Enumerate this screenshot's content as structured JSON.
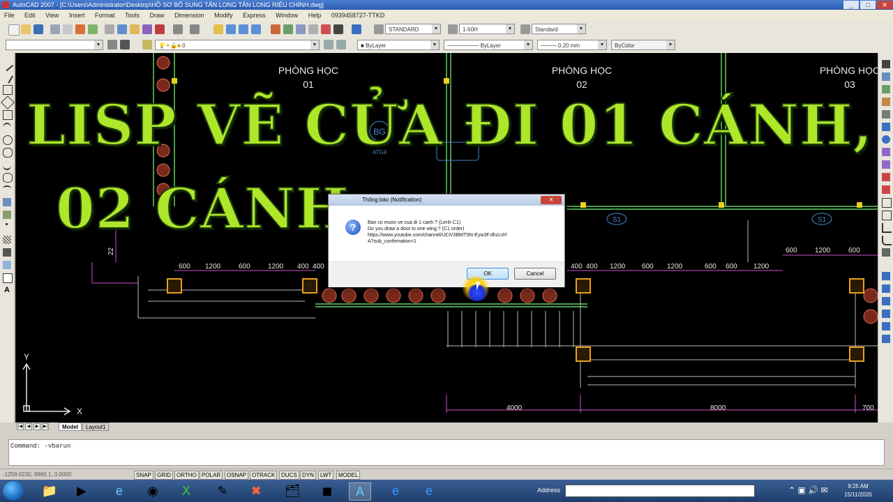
{
  "window": {
    "title": "AutoCAD 2007 - [C:\\Users\\Administrator\\Desktop\\HỒ SƠ BỔ SUNG TÂN LONG TÂN LONG RIÊU CHÍNH.dwg]",
    "minimize": "_",
    "maximize": "□",
    "close": "✕"
  },
  "menu": [
    "File",
    "Edit",
    "View",
    "Insert",
    "Format",
    "Tools",
    "Draw",
    "Dimension",
    "Modify",
    "Express",
    "Window",
    "Help",
    "0939458727-TTKD"
  ],
  "toolbar": {
    "text_style": "STANDARD",
    "dim_style": "1-50H",
    "table_style": "Standard",
    "layer_value": "0",
    "color": "ByLayer",
    "linetype": "ByLayer",
    "lineweight": "0.20 mm",
    "plot_style": "ByColor"
  },
  "drawing": {
    "rooms": [
      {
        "name": "PHÒNG HỌC",
        "number": "01"
      },
      {
        "name": "PHÒNG HỌC",
        "number": "02"
      },
      {
        "name": "PHÒNG HỌC",
        "number": "03"
      }
    ],
    "tags": [
      "S1",
      "S1",
      "BG",
      "ATG4"
    ],
    "dims_left": [
      "600",
      "1200",
      "600",
      "1200",
      "400",
      "400"
    ],
    "dims_mid": [
      "400",
      "400",
      "1200",
      "600",
      "1200",
      "600",
      "600",
      "1200"
    ],
    "dims_right_upper": [
      "600",
      "1200",
      "600"
    ],
    "dims_bottom": [
      "4000",
      "8000",
      "700"
    ],
    "side_dim": "22",
    "axis": {
      "x": "X",
      "y": "Y"
    }
  },
  "overlay": {
    "line1": "LISP VẼ CỬA ĐI 01 CÁNH,",
    "line2": "02 CÁNH"
  },
  "dialog": {
    "title": "Thông báo (Notification)",
    "close": "✕",
    "icon": "?",
    "message": [
      "Ban co muon ve cua di 1 canh ? (Lenh C1)",
      "Do you draw a door to one wing ? (C1 order)",
      "https://www.youtube.com/channel/UCiV3BMTSN-Eyw3F.dhzLVrf",
      "A?sub_confirmation=1"
    ],
    "ok": "OK",
    "cancel": "Cancel"
  },
  "tabs": {
    "model": "Model",
    "layout": "Layout1"
  },
  "command": {
    "line1": "Command: -vbarun"
  },
  "status": {
    "coords": "-1259.0230, 8960.1, 0.0000",
    "buttons": [
      "SNAP",
      "GRID",
      "ORTHO",
      "POLAR",
      "OSNAP",
      "OTRACK",
      "DUCS",
      "DYN",
      "LWT",
      "MODEL"
    ]
  },
  "taskbar": {
    "address_label": "Address",
    "time": "9:25 AM",
    "date": "15/11/2020"
  },
  "colors": {
    "overlay_text": "#aee62a",
    "drawing_bg": "#000000",
    "column_marker": "#e8a020",
    "wall_green": "#5fd35f",
    "dim_magenta": "#d04fd0"
  }
}
